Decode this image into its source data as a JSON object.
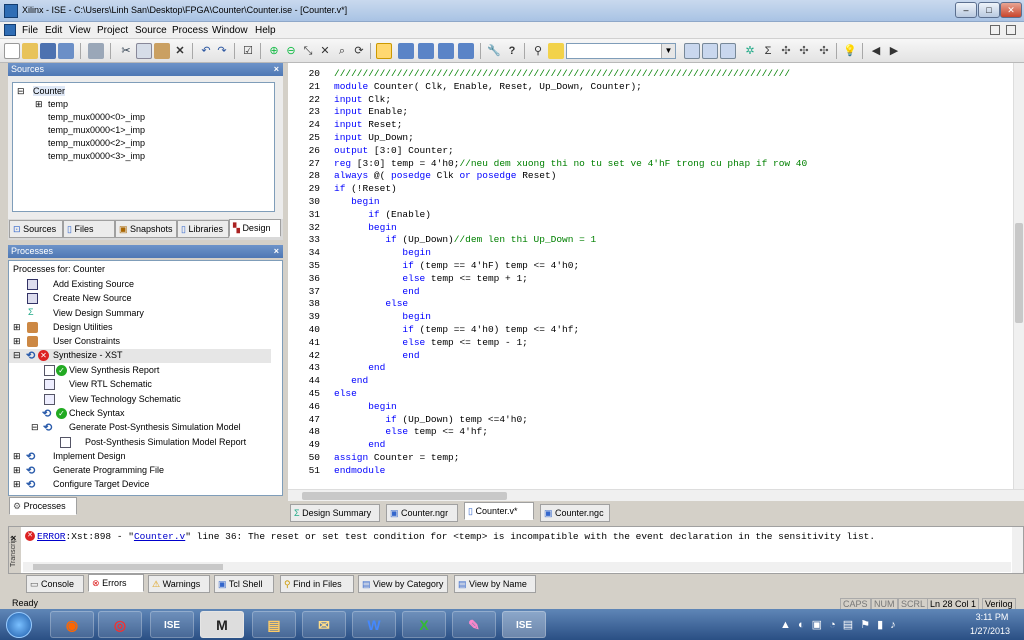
{
  "window": {
    "title": "Xilinx - ISE - C:\\Users\\Linh San\\Desktop\\FPGA\\Counter\\Counter.ise - [Counter.v*]",
    "min": "–",
    "max": "□",
    "close": "✕"
  },
  "menu": [
    "File",
    "Edit",
    "View",
    "Project",
    "Source",
    "Process",
    "Window",
    "Help"
  ],
  "sources": {
    "title": "Sources",
    "tree": [
      "Counter",
      "temp",
      "temp_mux0000<0>_imp",
      "temp_mux0000<1>_imp",
      "temp_mux0000<2>_imp",
      "temp_mux0000<3>_imp"
    ],
    "tabs": [
      "Sources",
      "Files",
      "Snapshots",
      "Libraries",
      "Design"
    ]
  },
  "processes": {
    "title": "Processes",
    "for_label": "Processes for: Counter",
    "items": [
      "Add Existing Source",
      "Create New Source",
      "View Design Summary",
      "Design Utilities",
      "User Constraints",
      "Synthesize - XST",
      "View Synthesis Report",
      "View RTL Schematic",
      "View Technology Schematic",
      "Check Syntax",
      "Generate Post-Synthesis Simulation Model",
      "Post-Synthesis Simulation Model Report",
      "Implement Design",
      "Generate Programming File",
      "Configure Target Device"
    ],
    "tab": "Processes"
  },
  "editor": {
    "lines": [
      {
        "n": "20",
        "t": "////////////////////////////////////////////////////////////////////////////////",
        "c": "cm"
      },
      {
        "n": "21",
        "t": "module Counter( Clk, Enable, Reset, Up_Down, Counter);",
        "c": ""
      },
      {
        "n": "22",
        "t": "input Clk;",
        "c": ""
      },
      {
        "n": "23",
        "t": "input Enable;",
        "c": ""
      },
      {
        "n": "24",
        "t": "input Reset;",
        "c": ""
      },
      {
        "n": "25",
        "t": "input Up_Down;",
        "c": ""
      },
      {
        "n": "26",
        "t": "output [3:0] Counter;",
        "c": ""
      },
      {
        "n": "27",
        "t": "reg [3:0] temp = 4'h0;//neu dem xuong thi no tu set ve 4'hF trong cu phap if row 40",
        "c": ""
      },
      {
        "n": "28",
        "t": "always @( posedge Clk or posedge Reset)",
        "c": ""
      },
      {
        "n": "29",
        "t": "if (!Reset)",
        "c": ""
      },
      {
        "n": "30",
        "t": "   begin",
        "c": "kw"
      },
      {
        "n": "31",
        "t": "      if (Enable)",
        "c": ""
      },
      {
        "n": "32",
        "t": "      begin",
        "c": "kw"
      },
      {
        "n": "33",
        "t": "         if (Up_Down)//dem len thi Up_Down = 1",
        "c": ""
      },
      {
        "n": "34",
        "t": "            begin",
        "c": "kw"
      },
      {
        "n": "35",
        "t": "            if (temp == 4'hF) temp <= 4'h0;",
        "c": ""
      },
      {
        "n": "36",
        "t": "            else temp <= temp + 1;",
        "c": ""
      },
      {
        "n": "37",
        "t": "            end",
        "c": "kw"
      },
      {
        "n": "38",
        "t": "         else",
        "c": "kw"
      },
      {
        "n": "39",
        "t": "            begin",
        "c": "kw"
      },
      {
        "n": "40",
        "t": "            if (temp == 4'h0) temp <= 4'hf;",
        "c": ""
      },
      {
        "n": "41",
        "t": "            else temp <= temp - 1;",
        "c": ""
      },
      {
        "n": "42",
        "t": "            end",
        "c": "kw"
      },
      {
        "n": "43",
        "t": "      end",
        "c": "kw"
      },
      {
        "n": "44",
        "t": "   end",
        "c": "kw"
      },
      {
        "n": "45",
        "t": "else",
        "c": "kw"
      },
      {
        "n": "46",
        "t": "      begin",
        "c": "kw"
      },
      {
        "n": "47",
        "t": "         if (Up_Down) temp <=4'h0;",
        "c": ""
      },
      {
        "n": "48",
        "t": "         else temp <= 4'hf;",
        "c": ""
      },
      {
        "n": "49",
        "t": "      end",
        "c": "kw"
      },
      {
        "n": "50",
        "t": "assign Counter = temp;",
        "c": ""
      },
      {
        "n": "51",
        "t": "endmodule",
        "c": "kw"
      }
    ],
    "tabs": [
      "Design Summary",
      "Counter.ngr",
      "Counter.v*",
      "Counter.ngc"
    ]
  },
  "console": {
    "error_prefix": "ERROR",
    "error_code": ":Xst:898 - \"",
    "error_file": "Counter.v",
    "error_rest": "\" line 36: The reset or set test condition for <temp> is incompatible with the event declaration in the sensitivity list.",
    "side_label": "Transcript",
    "tabs": [
      "Console",
      "Errors",
      "Warnings",
      "Tcl Shell",
      "Find in Files",
      "View by Category",
      "View by Name"
    ]
  },
  "status": {
    "left": "Ready",
    "caps": "CAPS",
    "num": "NUM",
    "scrl": "SCRL",
    "pos": "Ln 28 Col 1",
    "lang": "Verilog"
  },
  "taskbar": {
    "time": "3:11 PM",
    "date": "1/27/2013",
    "apps": [
      "firefox",
      "chrome",
      "ISE",
      "M",
      "explorer",
      "outlook",
      "word",
      "excel",
      "paint",
      "ISE"
    ]
  }
}
